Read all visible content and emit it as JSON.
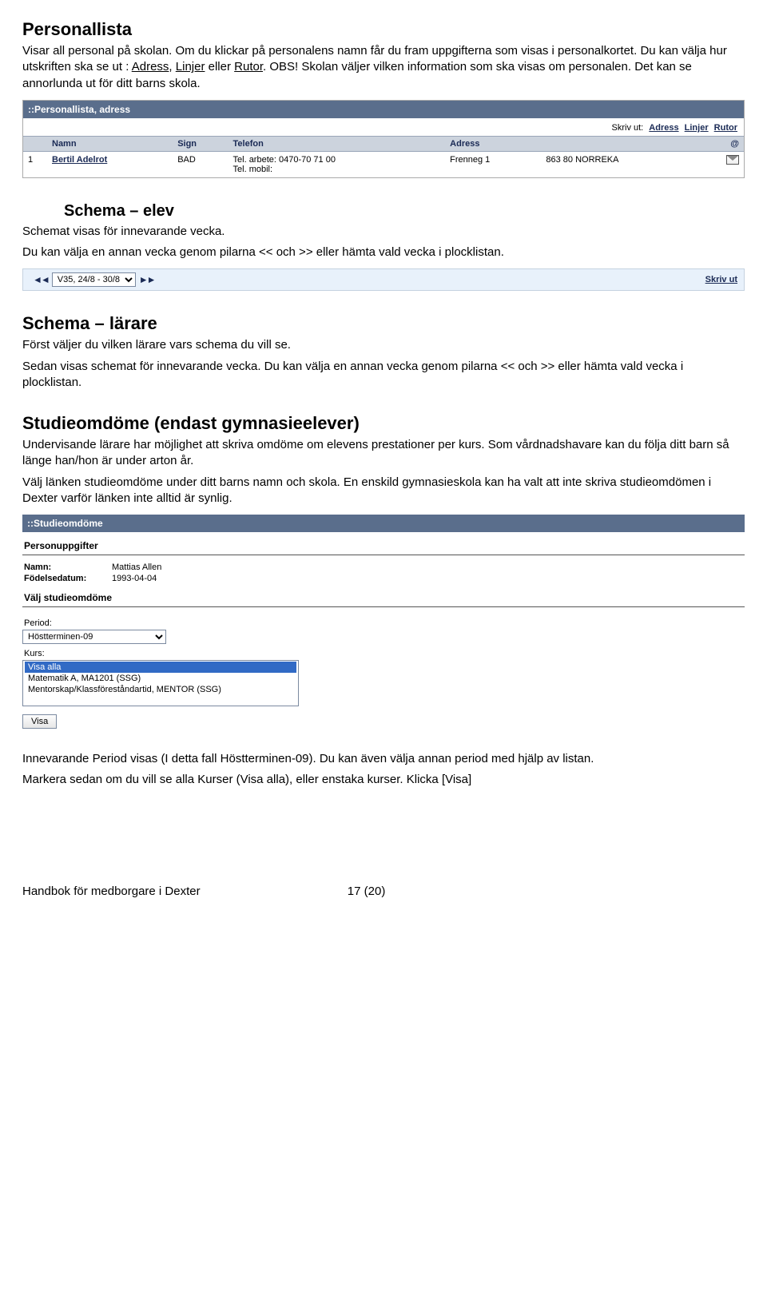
{
  "sec1": {
    "title": "Personallista",
    "p1a": "Visar all personal på skolan. Om du klickar på personalens namn får du fram uppgifterna som visas i personalkortet. Du kan välja hur utskriften ska se ut : ",
    "link1": "Adress",
    "sep": ", ",
    "link2": "Linjer",
    "or": " eller ",
    "link3": "Rutor",
    "p1b": ". OBS! Skolan väljer vilken information som ska visas om personalen. Det kan se annorlunda ut för ditt barns skola."
  },
  "personal_panel": {
    "bar": "::Personallista, adress",
    "skriv_ut": "Skriv ut:",
    "links": {
      "a": "Adress",
      "l": "Linjer",
      "r": "Rutor"
    },
    "headers": {
      "namn": "Namn",
      "sign": "Sign",
      "telefon": "Telefon",
      "adress": "Adress",
      "at": "@"
    },
    "row": {
      "num": "1",
      "name": "Bertil Adelrot",
      "sign": "BAD",
      "tel1": "Tel. arbete: 0470-70 71 00",
      "tel2": "Tel. mobil:",
      "adr": "Frenneg 1",
      "ort": "863 80 NORREKA"
    }
  },
  "sec2": {
    "title": "Schema – elev",
    "p1": "Schemat visas för innevarande vecka.",
    "p2": "Du kan välja en annan vecka genom pilarna << och  >> eller hämta vald vecka i plocklistan."
  },
  "schema_bar": {
    "left": "◄◄",
    "option": "V35, 24/8 - 30/8",
    "right": "►►",
    "print": "Skriv ut"
  },
  "sec3": {
    "title": "Schema – lärare",
    "p1": "Först väljer du vilken lärare vars schema du vill se.",
    "p2": "Sedan visas schemat för innevarande vecka. Du kan välja en annan vecka genom pilarna << och >> eller hämta vald vecka i plocklistan."
  },
  "sec4": {
    "title": "Studieomdöme (endast gymnasieelever)",
    "p1": "Undervisande lärare har möjlighet att skriva omdöme om elevens prestationer per kurs. Som vårdnadshavare kan du följa ditt barn så länge han/hon är under arton år.",
    "p2": "Välj länken studieomdöme under ditt barns namn och skola. En enskild gymnasieskola kan ha valt att inte skriva studieomdömen i Dexter varför länken inte alltid är synlig."
  },
  "studie_panel": {
    "bar": "::Studieomdöme",
    "sub1": "Personuppgifter",
    "name_k": "Namn:",
    "name_v": "Mattias Allen",
    "dob_k": "Födelsedatum:",
    "dob_v": "1993-04-04",
    "sub2": "Välj studieomdöme",
    "period_label": "Period:",
    "period_value": "Höstterminen-09",
    "kurs_label": "Kurs:",
    "kurs_options": {
      "a": "Visa alla",
      "b": "Matematik A, MA1201 (SSG)",
      "c": "Mentorskap/Klassföreståndartid, MENTOR (SSG)"
    },
    "button": "Visa"
  },
  "sec5": {
    "p1": "Innevarande Period visas (I detta fall Höstterminen-09). Du kan även välja annan period med hjälp av listan.",
    "p2": "Markera sedan om du vill se alla Kurser (Visa alla), eller enstaka kurser. Klicka [Visa]"
  },
  "footer": {
    "left": "Handbok för medborgare i Dexter",
    "page": "17 (20)"
  }
}
